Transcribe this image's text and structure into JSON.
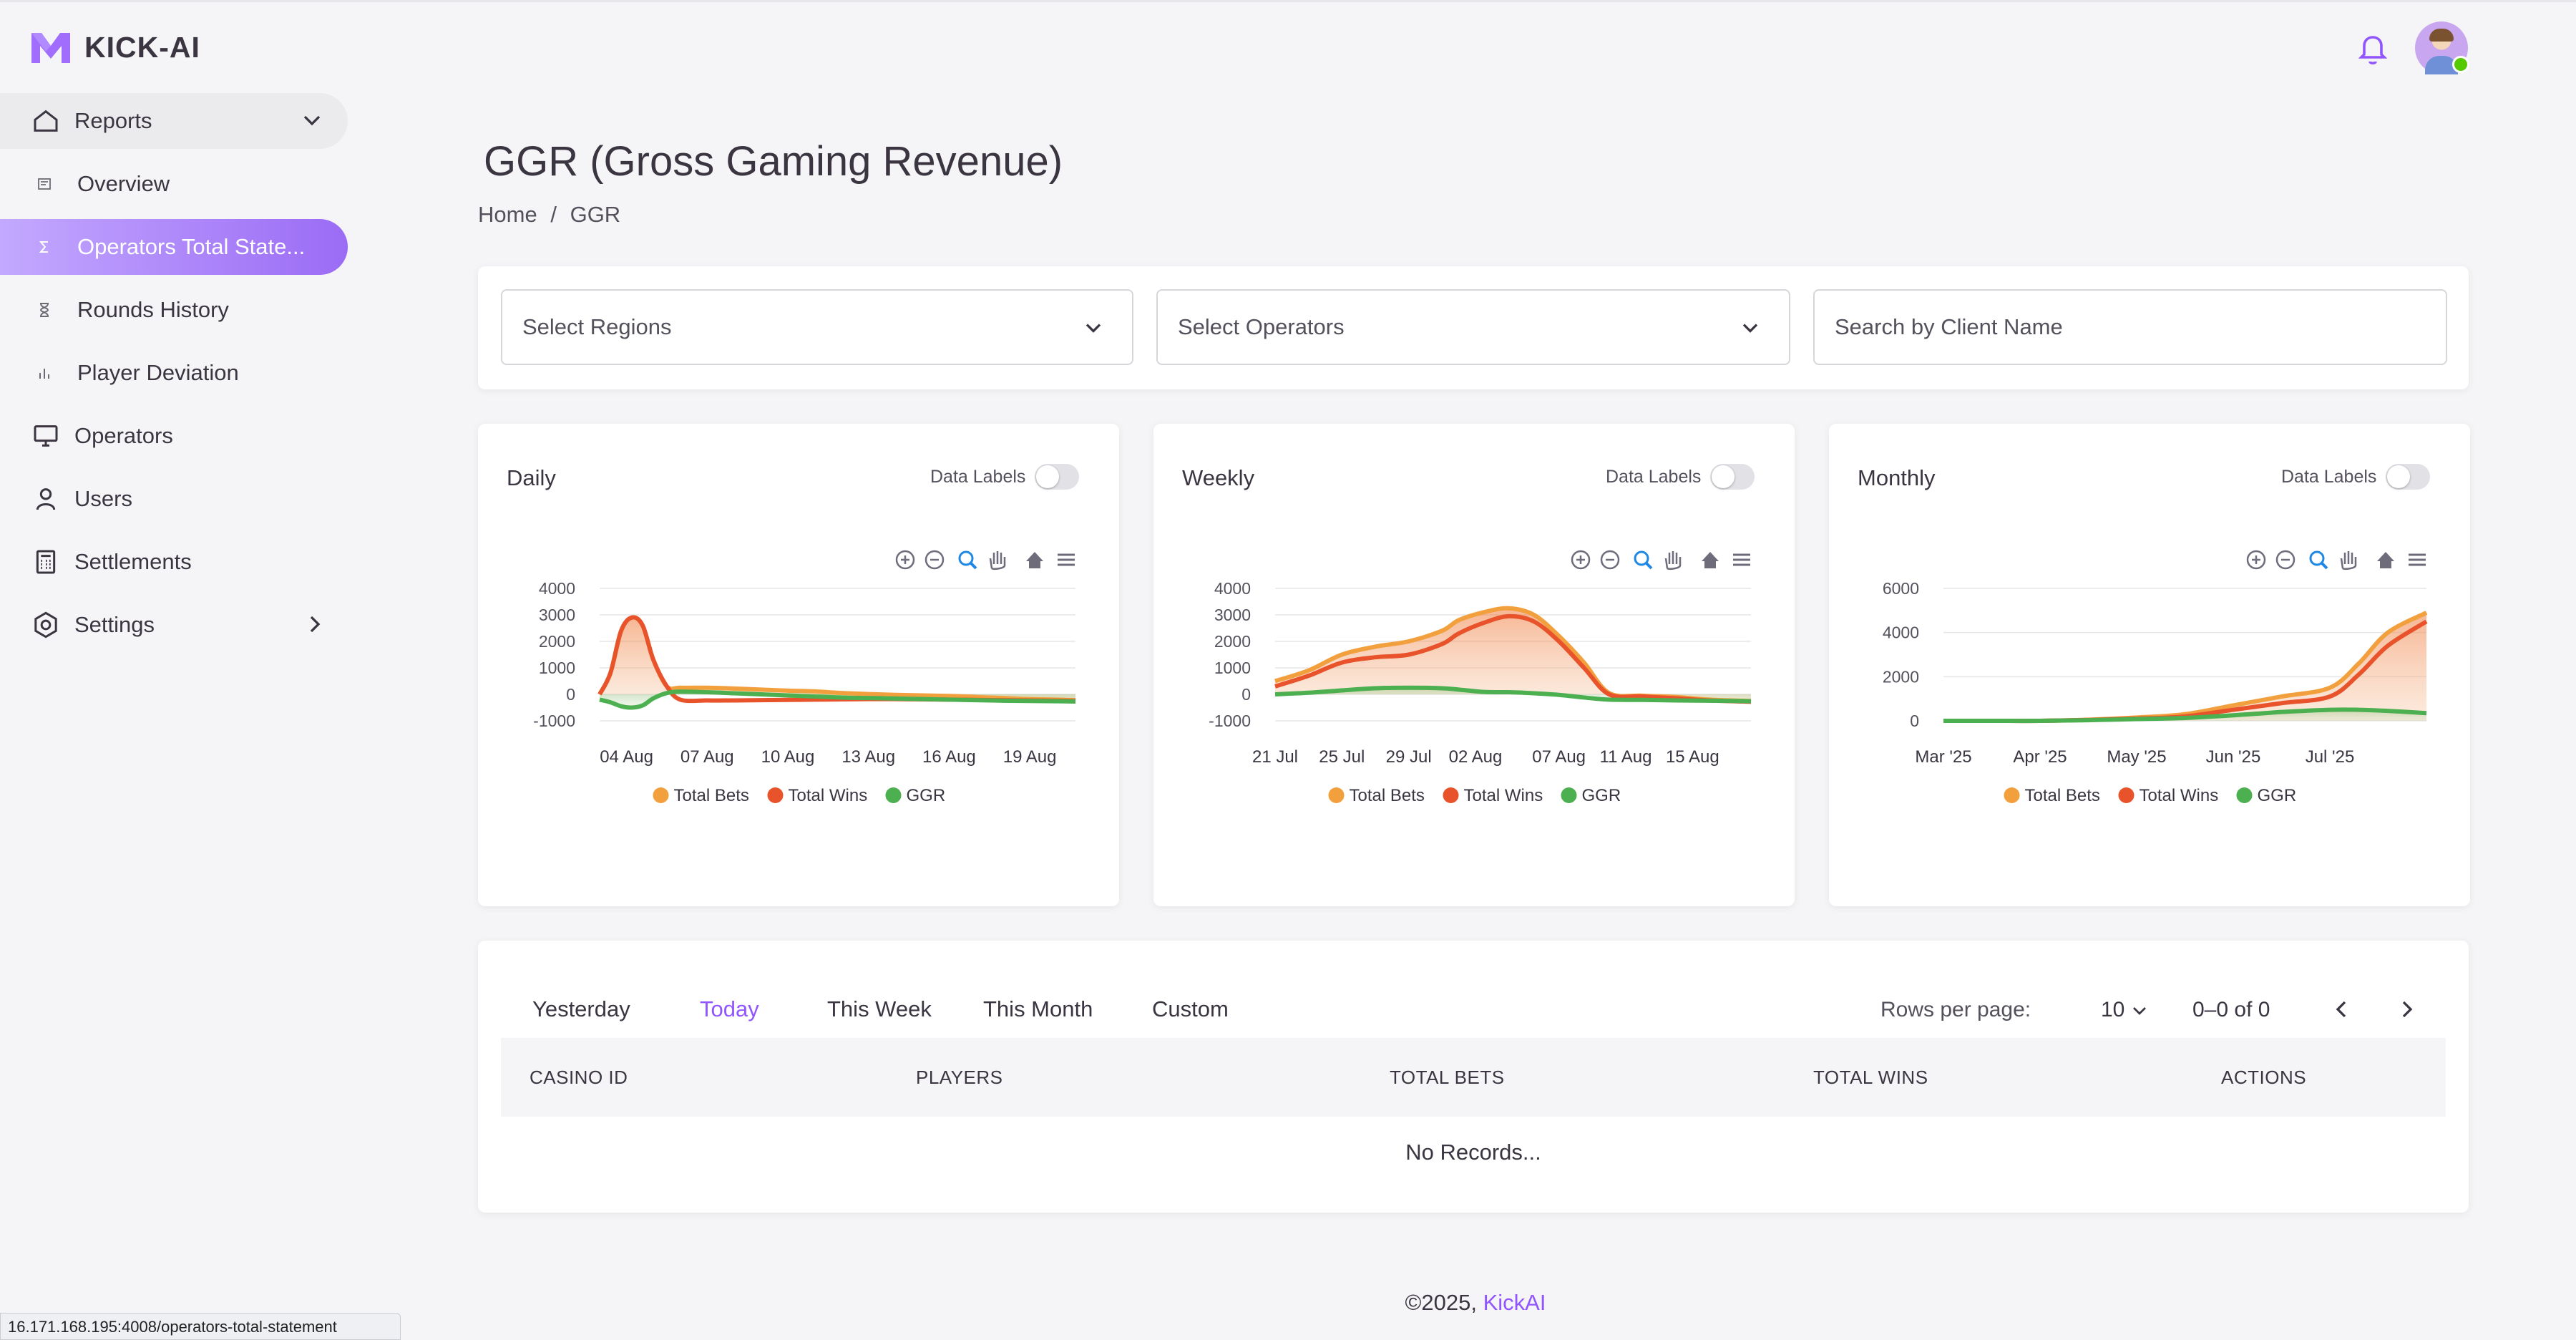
{
  "app": {
    "name": "KICK-AI"
  },
  "sidebar": {
    "items": [
      {
        "label": "Reports",
        "icon": "home-icon"
      },
      {
        "label": "Overview",
        "icon": "overview-icon"
      },
      {
        "label": "Operators Total State...",
        "icon": "sigma-icon"
      },
      {
        "label": "Rounds History",
        "icon": "hourglass-icon"
      },
      {
        "label": "Player Deviation",
        "icon": "bar-chart-icon"
      },
      {
        "label": "Operators",
        "icon": "monitor-icon"
      },
      {
        "label": "Users",
        "icon": "user-icon"
      },
      {
        "label": "Settlements",
        "icon": "calculator-icon"
      },
      {
        "label": "Settings",
        "icon": "settings-icon"
      }
    ]
  },
  "header": {
    "title": "GGR (Gross Gaming Revenue)",
    "breadcrumb": {
      "home": "Home",
      "sep": "/",
      "current": "GGR"
    }
  },
  "filters": {
    "regions": "Select Regions",
    "operators": "Select Operators",
    "search_placeholder": "Search by Client Name"
  },
  "charts": {
    "data_labels": "Data Labels",
    "legend": [
      "Total Bets",
      "Total Wins",
      "GGR"
    ]
  },
  "colors": {
    "accent": "#9155fd",
    "total_bets": "#f2a03d",
    "total_wins": "#e8532b",
    "ggr": "#4caf50"
  },
  "chart_data": [
    {
      "type": "area",
      "title": "Daily",
      "ylim": [
        -1000,
        4000
      ],
      "yticks": [
        "4000",
        "3000",
        "2000",
        "1000",
        "0",
        "-1000"
      ],
      "xticks": [
        "04 Aug",
        "07 Aug",
        "10 Aug",
        "13 Aug",
        "16 Aug",
        "19 Aug"
      ],
      "x": [
        3,
        3.4,
        3.8,
        4.2,
        4.6,
        5.0,
        5.5,
        6.0,
        7,
        8,
        9,
        10,
        11,
        12,
        13,
        14,
        15,
        16,
        17,
        18,
        19,
        20,
        20.7
      ],
      "series": [
        {
          "name": "Total Bets",
          "values": [
            0,
            800,
            2400,
            2900,
            2600,
            1300,
            300,
            250,
            250,
            220,
            180,
            140,
            110,
            50,
            10,
            -20,
            -40,
            -60,
            -100,
            -140,
            -180,
            -200,
            -220
          ]
        },
        {
          "name": "Total Wins",
          "values": [
            0,
            800,
            2400,
            2900,
            2600,
            1300,
            300,
            -200,
            -230,
            -230,
            -220,
            -210,
            -200,
            -190,
            -180,
            -180,
            -190,
            -200,
            -210,
            -220,
            -230,
            -240,
            -250
          ]
        },
        {
          "name": "GGR",
          "values": [
            -200,
            -300,
            -450,
            -500,
            -420,
            -150,
            50,
            100,
            80,
            40,
            0,
            -40,
            -80,
            -120,
            -140,
            -160,
            -180,
            -200,
            -220,
            -240,
            -250,
            -260,
            -270
          ]
        }
      ]
    },
    {
      "type": "area",
      "title": "Weekly",
      "ylim": [
        -1000,
        4000
      ],
      "yticks": [
        "4000",
        "3000",
        "2000",
        "1000",
        "0",
        "-1000"
      ],
      "xticks": [
        "21 Jul",
        "25 Jul",
        "29 Jul",
        "02 Aug",
        "07 Aug",
        "11 Aug",
        "15 Aug"
      ],
      "x": [
        21,
        23,
        25,
        27,
        29,
        31,
        32,
        33.5,
        35,
        36.5,
        38,
        39.5,
        41,
        43,
        45,
        47,
        49.5
      ],
      "series": [
        {
          "name": "Total Bets",
          "values": [
            500,
            900,
            1500,
            1800,
            2000,
            2400,
            2800,
            3100,
            3250,
            3000,
            2200,
            1200,
            50,
            -50,
            -100,
            -200,
            -250
          ]
        },
        {
          "name": "Total Wins",
          "values": [
            300,
            700,
            1200,
            1400,
            1500,
            1900,
            2300,
            2700,
            2950,
            2750,
            2000,
            1000,
            0,
            -80,
            -150,
            -230,
            -280
          ]
        },
        {
          "name": "GGR",
          "values": [
            0,
            60,
            150,
            230,
            250,
            230,
            180,
            90,
            80,
            40,
            -20,
            -120,
            -200,
            -210,
            -230,
            -240,
            -260
          ]
        }
      ]
    },
    {
      "type": "area",
      "title": "Monthly",
      "ylim": [
        0,
        6000
      ],
      "yticks": [
        "6000",
        "4000",
        "2000",
        "0"
      ],
      "xticks": [
        "Mar '25",
        "Apr '25",
        "May '25",
        "Jun '25",
        "Jul '25"
      ],
      "x": [
        3,
        3.5,
        4,
        4.5,
        5,
        5.5,
        6,
        6.5,
        7,
        7.3,
        7.6,
        8.0
      ],
      "series": [
        {
          "name": "Total Bets",
          "values": [
            0,
            0,
            0,
            50,
            150,
            300,
            700,
            1100,
            1500,
            2600,
            4000,
            4900
          ]
        },
        {
          "name": "Total Wins",
          "values": [
            0,
            0,
            0,
            40,
            100,
            200,
            500,
            800,
            1100,
            2100,
            3400,
            4500
          ]
        },
        {
          "name": "GGR",
          "values": [
            0,
            0,
            0,
            30,
            80,
            130,
            250,
            400,
            500,
            500,
            450,
            350
          ]
        }
      ]
    }
  ],
  "table": {
    "tabs": [
      "Yesterday",
      "Today",
      "This Week",
      "This Month",
      "Custom"
    ],
    "active_tab": "Today",
    "rows_per_page_label": "Rows per page:",
    "rows_per_page": "10",
    "page_info": "0–0 of 0",
    "columns": [
      "CASINO ID",
      "PLAYERS",
      "TOTAL BETS",
      "TOTAL WINS",
      "ACTIONS"
    ],
    "empty": "No Records..."
  },
  "footer": {
    "copyright": "©2025,",
    "brand": "KickAI"
  },
  "status_url": "16.171.168.195:4008/operators-total-statement"
}
